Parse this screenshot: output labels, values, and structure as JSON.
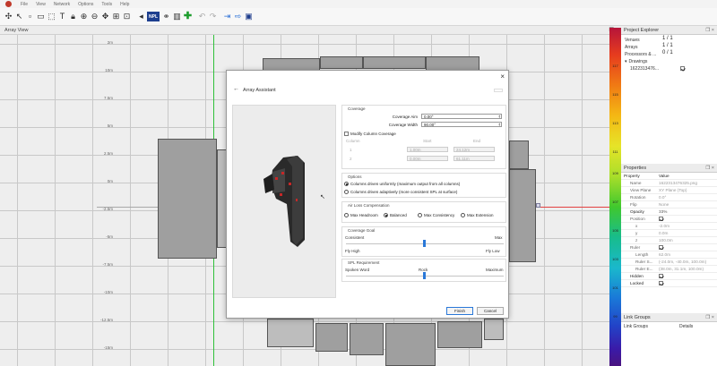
{
  "menu": {
    "items": [
      "File",
      "View",
      "Network",
      "Options",
      "Tools",
      "Help"
    ]
  },
  "toolbar": {
    "chip_label": "NPL"
  },
  "array_view": {
    "title": "Array View",
    "controls": "❒ ×"
  },
  "canvas": {
    "y_labels": [
      "2m",
      "10m",
      "7.5m",
      "5m",
      "2.5m",
      "0m",
      "-2.5m",
      "-5m",
      "-7.5m",
      "-10m",
      "-12.5m",
      "-15m",
      "-17.5m"
    ]
  },
  "scale": {
    "labels": [
      "117",
      "115",
      "113",
      "111",
      "109",
      "107",
      "105",
      "103",
      "101",
      "99"
    ]
  },
  "project_explorer": {
    "title": "Project Explorer",
    "controls": "❒ ×",
    "items": [
      {
        "label": "Venues",
        "value": "1 / 1"
      },
      {
        "label": "Arrays",
        "value": "1 / 1"
      },
      {
        "label": "Processors & ...",
        "value": "0 / 1"
      },
      {
        "label": "Drawings",
        "value": ""
      },
      {
        "label": "1622313476...",
        "value": ""
      }
    ]
  },
  "properties": {
    "title": "Properties",
    "controls": "❒ ×",
    "header_property": "Property",
    "header_value": "Value",
    "rows": [
      {
        "k": "Name",
        "v": "1622313476325.png"
      },
      {
        "k": "View Plane",
        "v": "XY Plane (Top)"
      },
      {
        "k": "Rotation",
        "v": "0.0°"
      },
      {
        "k": "Flip",
        "v": "None"
      },
      {
        "k": "Opacity",
        "v": "33%"
      },
      {
        "k": "Position",
        "v": ""
      },
      {
        "k": "x",
        "v": "-2.0m"
      },
      {
        "k": "y",
        "v": "0.0m"
      },
      {
        "k": "z",
        "v": "100.0m"
      },
      {
        "k": "Ruler",
        "v": ""
      },
      {
        "k": "Length",
        "v": "62.0m"
      },
      {
        "k": "Ruler S...",
        "v": "(-24.0m, -40.0m, 100.0m)"
      },
      {
        "k": "Ruler E...",
        "v": "(38.0m, 31.1m, 100.0m)"
      },
      {
        "k": "Hidden",
        "v": ""
      },
      {
        "k": "Locked",
        "v": ""
      }
    ]
  },
  "link_groups": {
    "title": "Link Groups",
    "controls": "❒ ×",
    "col1": "Link Groups",
    "col2": "Details"
  },
  "dialog": {
    "title": "Array Assistant",
    "close": "×",
    "back": "←",
    "coverage": {
      "group_title": "Coverage",
      "angle_label": "Coverage Aim",
      "angle_value": "0.00°",
      "width_label": "Coverage Width",
      "width_value": "90.00°",
      "modify_label": "Modify Column Coverage",
      "col_hdr": "Column",
      "start_hdr": "Start",
      "end_hdr": "End",
      "rows": [
        {
          "col": "1",
          "start": "1.00m",
          "end": "24.12m"
        },
        {
          "col": "2",
          "start": "0.00m",
          "end": "61.11m"
        }
      ]
    },
    "options": {
      "group_title": "Options",
      "opt1": "Columns driven uniformly (maximum output from all columns)",
      "opt2": "Columns driven adaptively (more consistent SPL at surface)"
    },
    "air_loss": {
      "group_title": "Air Loss Compensation",
      "options": [
        "Max Headroom",
        "Balanced",
        "Max Consistency",
        "Max Extension"
      ]
    },
    "coverage_goal": {
      "group_title": "Coverage Goal",
      "left": "Consistent",
      "right": "Max",
      "left2": "Fly High",
      "right2": "Fly Low"
    },
    "spl": {
      "group_title": "SPL Requirement",
      "left": "Spoken Word",
      "mid": "Rock",
      "right": "Maximum"
    },
    "finish": "Finish",
    "cancel": "Cancel"
  },
  "colors": {
    "accent": "#2a78d8",
    "origin_x": "#e34141",
    "origin_y": "#2fc13a",
    "toolbar_chip": "#1d3f8f"
  }
}
